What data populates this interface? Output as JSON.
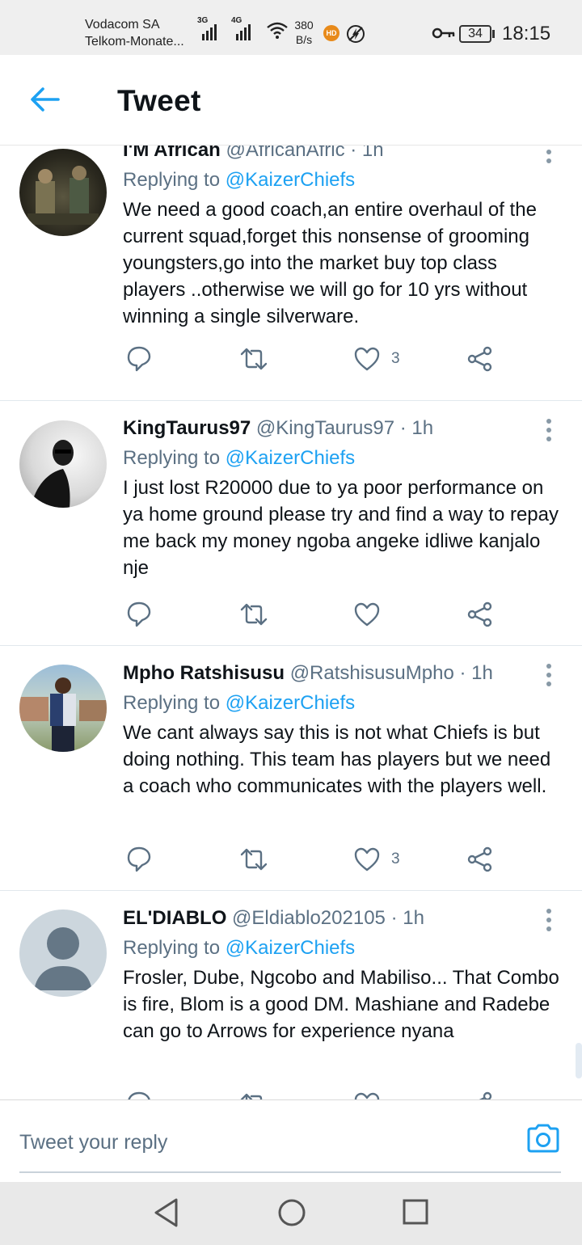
{
  "status_bar": {
    "carrier_1": "Vodacom SA",
    "carrier_2": "Telkom-Monate...",
    "signal_1_label": "3G",
    "signal_2_label": "4G",
    "speed_value": "380",
    "speed_unit": "B/s",
    "hd_badge": "HD",
    "battery": "34",
    "time": "18:15"
  },
  "header": {
    "title": "Tweet"
  },
  "tweets": [
    {
      "name": "I'M African",
      "handle": "@AfricanAfric",
      "separator": "·",
      "time": "1h",
      "replying_prefix": "Replying to",
      "replying_to": "@KaizerChiefs",
      "text": "We need a good coach,an entire overhaul of the current squad,forget this nonsense of grooming youngsters,go into the market buy top class players ..otherwise we will go for 10 yrs without winning a single silverware.",
      "likes": "3"
    },
    {
      "name": "KingTaurus97",
      "handle": "@KingTaurus97",
      "separator": "·",
      "time": "1h",
      "replying_prefix": "Replying to",
      "replying_to": "@KaizerChiefs",
      "text": "I just lost R20000 due to ya poor performance on ya home ground please try and find a way to repay me back my money ngoba angeke idliwe kanjalo nje",
      "likes": ""
    },
    {
      "name": "Mpho Ratshisusu",
      "handle": "@RatshisusuMpho",
      "separator": "·",
      "time": "1h",
      "replying_prefix": "Replying to",
      "replying_to": "@KaizerChiefs",
      "text": "We cant always say this is not what Chiefs is but doing nothing. This team has players but we need a coach who communicates with the players well.",
      "likes": "3"
    },
    {
      "name": "EL'DIABLO",
      "handle": "@Eldiablo202105",
      "separator": "·",
      "time": "1h",
      "replying_prefix": "Replying to",
      "replying_to": "@KaizerChiefs",
      "text": "Frosler, Dube, Ngcobo and Mabiliso... That Combo is fire, Blom is a good DM. Mashiane and Radebe can go to Arrows for experience nyana",
      "likes": ""
    }
  ],
  "reply_bar": {
    "placeholder": "Tweet your reply"
  },
  "colors": {
    "accent": "#1da1f2",
    "secondary_text": "#5b7083",
    "primary_text": "#0f1419"
  },
  "icons": {
    "back": "arrow-left-icon",
    "reply": "comment-icon",
    "retweet": "retweet-icon",
    "like": "heart-icon",
    "share": "share-icon",
    "more": "more-vertical-icon",
    "camera": "camera-icon"
  }
}
